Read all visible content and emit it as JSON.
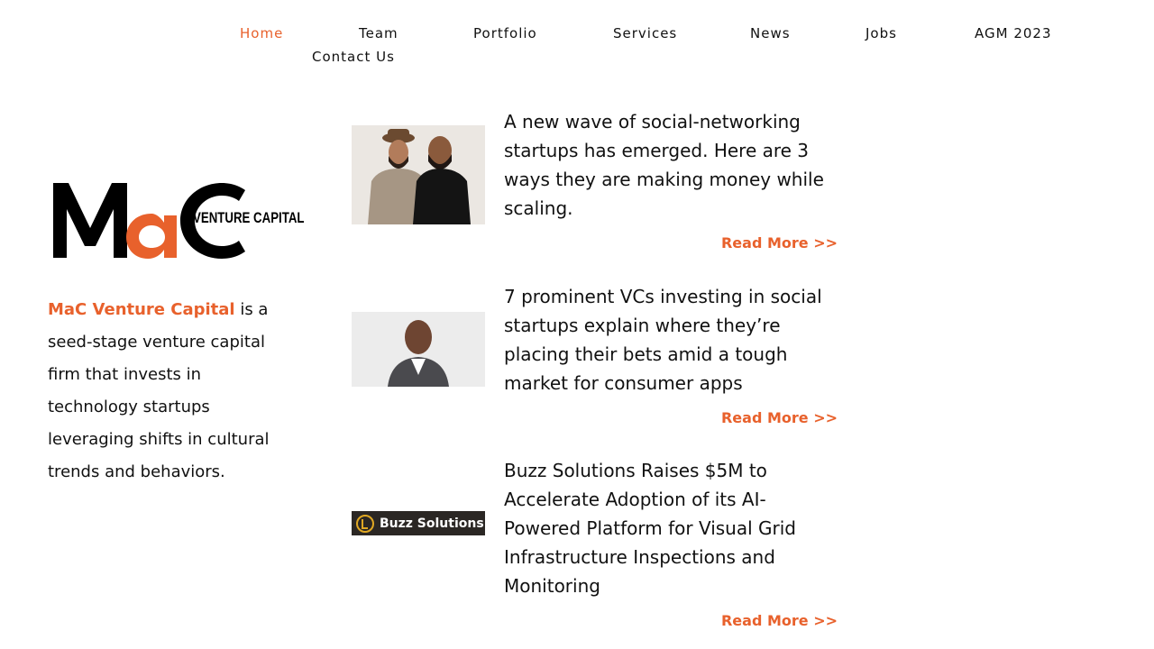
{
  "nav": {
    "items": [
      {
        "label": "Home",
        "active": true
      },
      {
        "label": "Team"
      },
      {
        "label": "Portfolio"
      },
      {
        "label": "Services"
      },
      {
        "label": "News"
      },
      {
        "label": "Jobs"
      },
      {
        "label": "AGM 2023"
      },
      {
        "label": "Contact Us"
      }
    ]
  },
  "logo": {
    "letters": [
      "M",
      "a",
      "C"
    ],
    "tagline": "VENTURE CAPITAL",
    "accent_color": "#e8612c"
  },
  "intro": {
    "brand": "MaC Venture Capital",
    "text": " is a seed-stage venture capital firm that invests in technology startups leveraging shifts in cultural trends and behaviors."
  },
  "articles": [
    {
      "headline": "A new wave of social-networking startups has emerged. Here are 3 ways they are making money while scaling.",
      "read_more": "Read More >>",
      "image": "two-men-photo"
    },
    {
      "headline": "7 prominent VCs investing in social startups explain where they’re placing their bets amid a tough market for consumer apps",
      "read_more": "Read More >>",
      "image": "man-in-suit-photo"
    },
    {
      "headline": "Buzz Solutions Raises $5M to Accelerate Adoption of its AI-Powered Platform for Visual Grid Infrastructure Inspections and Monitoring",
      "read_more": "Read More >>",
      "image": "buzz-solutions-logo",
      "image_text": "Buzz Solutions"
    }
  ],
  "colors": {
    "accent": "#e8612c",
    "text": "#111111",
    "background": "#ffffff"
  }
}
